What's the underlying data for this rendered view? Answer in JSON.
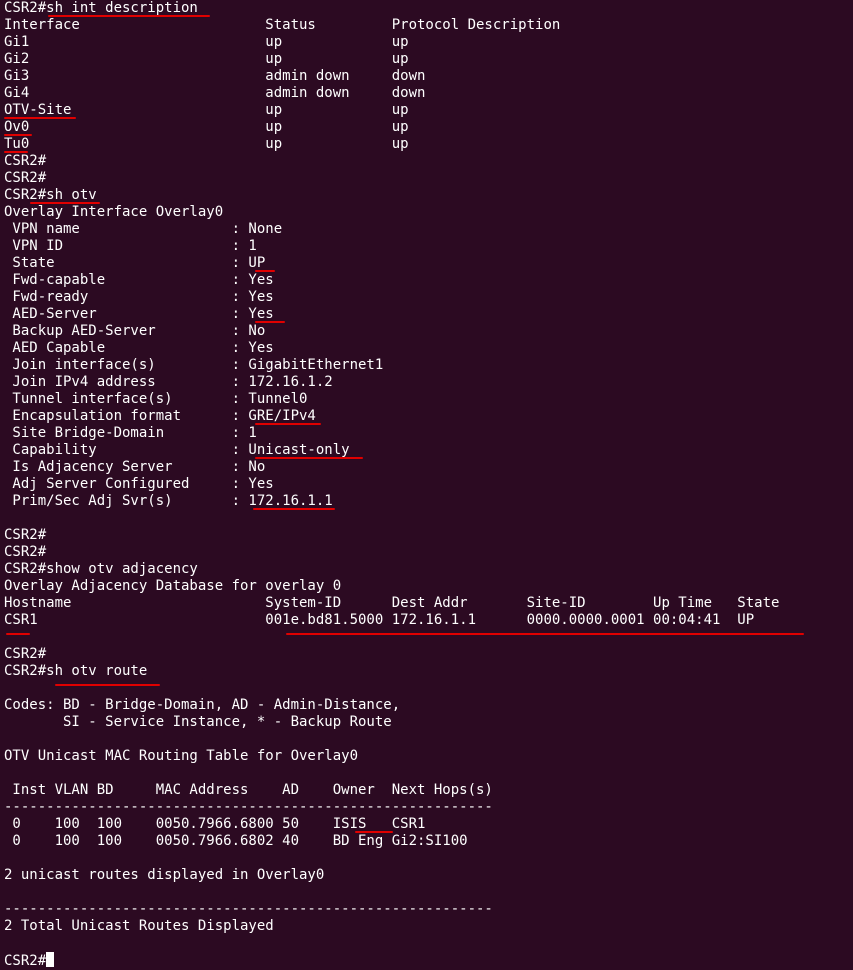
{
  "terminal": {
    "lines": [
      "CSR2#sh int description",
      "Interface                      Status         Protocol Description",
      "Gi1                            up             up",
      "Gi2                            up             up",
      "Gi3                            admin down     down",
      "Gi4                            admin down     down",
      "OTV-Site                       up             up",
      "Ov0                            up             up",
      "Tu0                            up             up",
      "CSR2#",
      "CSR2#",
      "CSR2#sh otv",
      "Overlay Interface Overlay0",
      " VPN name                  : None",
      " VPN ID                    : 1",
      " State                     : UP",
      " Fwd-capable               : Yes",
      " Fwd-ready                 : Yes",
      " AED-Server                : Yes",
      " Backup AED-Server         : No",
      " AED Capable               : Yes",
      " Join interface(s)         : GigabitEthernet1",
      " Join IPv4 address         : 172.16.1.2",
      " Tunnel interface(s)       : Tunnel0",
      " Encapsulation format      : GRE/IPv4",
      " Site Bridge-Domain        : 1",
      " Capability                : Unicast-only",
      " Is Adjacency Server       : No",
      " Adj Server Configured     : Yes",
      " Prim/Sec Adj Svr(s)       : 172.16.1.1",
      "",
      "CSR2#",
      "CSR2#",
      "CSR2#show otv adjacency",
      "Overlay Adjacency Database for overlay 0",
      "Hostname                       System-ID      Dest Addr       Site-ID        Up Time   State",
      "CSR1                           001e.bd81.5000 172.16.1.1      0000.0000.0001 00:04:41  UP",
      "",
      "CSR2#",
      "CSR2#sh otv route",
      "",
      "Codes: BD - Bridge-Domain, AD - Admin-Distance,",
      "       SI - Service Instance, * - Backup Route",
      "",
      "OTV Unicast MAC Routing Table for Overlay0",
      "",
      " Inst VLAN BD     MAC Address    AD    Owner  Next Hops(s)",
      "----------------------------------------------------------",
      " 0    100  100    0050.7966.6800 50    ISIS   CSR1",
      " 0    100  100    0050.7966.6802 40    BD Eng Gi2:SI100",
      "",
      "2 unicast routes displayed in Overlay0",
      "",
      "----------------------------------------------------------",
      "2 Total Unicast Routes Displayed",
      "",
      "CSR2#"
    ]
  },
  "colors": {
    "background": "#2c0a22",
    "text": "#ffffff",
    "annotation": "#e00000"
  }
}
